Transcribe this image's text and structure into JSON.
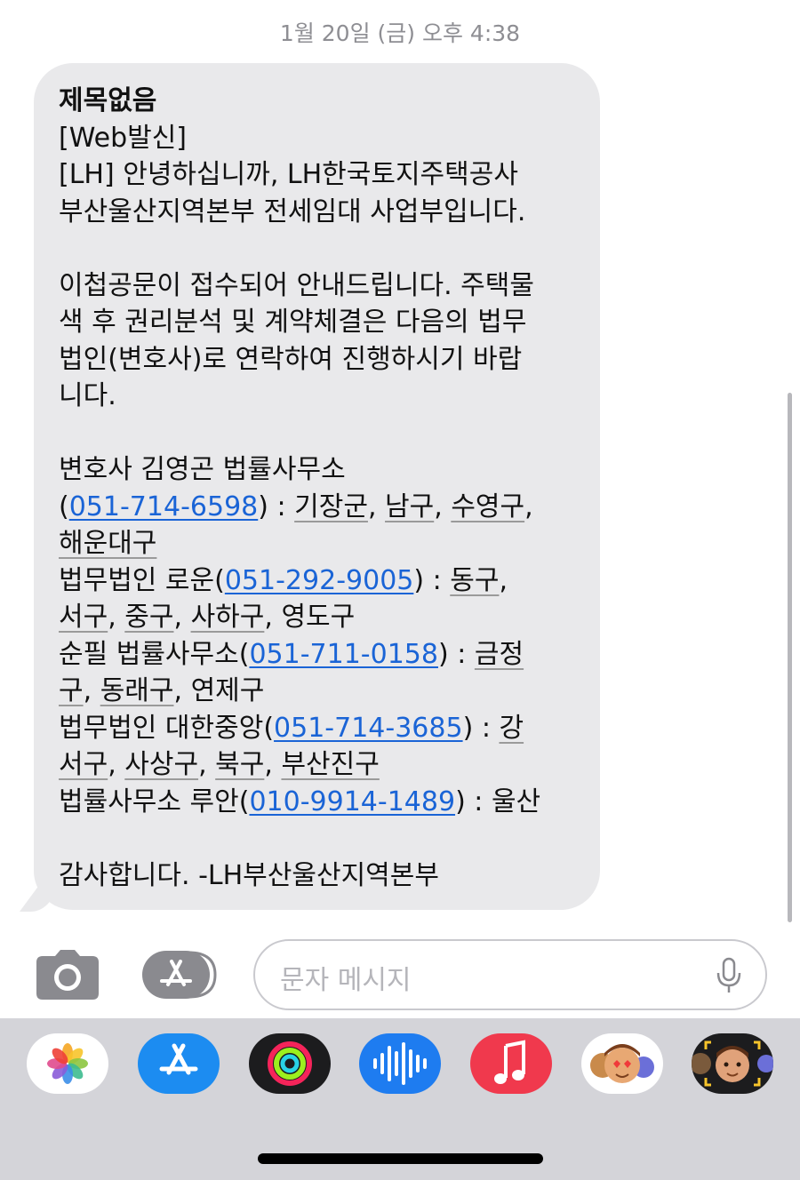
{
  "header": {
    "timestamp": "1월 20일 (금) 오후 4:38"
  },
  "message": {
    "lines": [
      [
        {
          "t": "제목없음",
          "k": "subject"
        }
      ],
      [
        {
          "t": "[Web발신]"
        }
      ],
      [
        {
          "t": "[LH] 안녕하십니까, LH한국토지주택공사"
        }
      ],
      [
        {
          "t": "부산울산지역본부 전세임대 사업부입니다."
        }
      ],
      [
        {
          "t": ""
        }
      ],
      [
        {
          "t": "이첩공문이 접수되어 안내드립니다. 주택물"
        }
      ],
      [
        {
          "t": "색 후 권리분석 및 계약체결은 다음의 법무"
        }
      ],
      [
        {
          "t": "법인(변호사)로 연락하여 진행하시기 바랍"
        }
      ],
      [
        {
          "t": "니다."
        }
      ],
      [
        {
          "t": ""
        }
      ],
      [
        {
          "t": "변호사 김영곤 법률사무소"
        }
      ],
      [
        {
          "t": "("
        },
        {
          "t": "051-714-6598",
          "k": "phone"
        },
        {
          "t": ") : "
        },
        {
          "t": "기장군",
          "k": "area"
        },
        {
          "t": ", "
        },
        {
          "t": "남구",
          "k": "area"
        },
        {
          "t": ", "
        },
        {
          "t": "수영구",
          "k": "area"
        },
        {
          "t": ","
        }
      ],
      [
        {
          "t": "해운대구",
          "k": "area"
        }
      ],
      [
        {
          "t": "법무법인 로운("
        },
        {
          "t": "051-292-9005",
          "k": "phone"
        },
        {
          "t": ") : "
        },
        {
          "t": "동구",
          "k": "area"
        },
        {
          "t": ","
        }
      ],
      [
        {
          "t": "서구",
          "k": "area"
        },
        {
          "t": ", "
        },
        {
          "t": "중구",
          "k": "area"
        },
        {
          "t": ", "
        },
        {
          "t": "사하구",
          "k": "area"
        },
        {
          "t": ", 영도구"
        }
      ],
      [
        {
          "t": "순필 법률사무소("
        },
        {
          "t": "051-711-0158",
          "k": "phone"
        },
        {
          "t": ") : "
        },
        {
          "t": "금정",
          "k": "area"
        }
      ],
      [
        {
          "t": "구",
          "k": "area"
        },
        {
          "t": ", "
        },
        {
          "t": "동래구",
          "k": "area"
        },
        {
          "t": ", 연제구"
        }
      ],
      [
        {
          "t": "법무법인 대한중앙("
        },
        {
          "t": "051-714-3685",
          "k": "phone"
        },
        {
          "t": ") : "
        },
        {
          "t": "강",
          "k": "area"
        }
      ],
      [
        {
          "t": "서구",
          "k": "area"
        },
        {
          "t": ", "
        },
        {
          "t": "사상구",
          "k": "area"
        },
        {
          "t": ", "
        },
        {
          "t": "북구",
          "k": "area"
        },
        {
          "t": ", "
        },
        {
          "t": "부산진구",
          "k": "area"
        }
      ],
      [
        {
          "t": "법률사무소 루안("
        },
        {
          "t": "010-9914-1489",
          "k": "phone"
        },
        {
          "t": ") : 울산"
        }
      ],
      [
        {
          "t": ""
        }
      ],
      [
        {
          "t": "감사합니다. -LH부산울산지역본부"
        }
      ]
    ]
  },
  "input_bar": {
    "placeholder": "문자 메시지"
  },
  "app_drawer": {
    "apps": [
      {
        "name": "photos-app-icon",
        "bg": "#ffffff"
      },
      {
        "name": "app-store-app-icon",
        "bg": "#1c8cf1"
      },
      {
        "name": "activity-app-icon",
        "bg": "#1c1c1e"
      },
      {
        "name": "audio-message-app-icon",
        "bg": "#1e7cf0"
      },
      {
        "name": "music-app-icon",
        "bg": "#f0394d"
      },
      {
        "name": "memoji-stickers-app-icon",
        "bg": "#ffffff"
      },
      {
        "name": "memoji-app-icon",
        "bg": "#1c1c1e"
      }
    ]
  },
  "colors": {
    "bubble": "#e9e9eb",
    "link": "#1a64d6",
    "drawer": "#d4d4d9"
  }
}
